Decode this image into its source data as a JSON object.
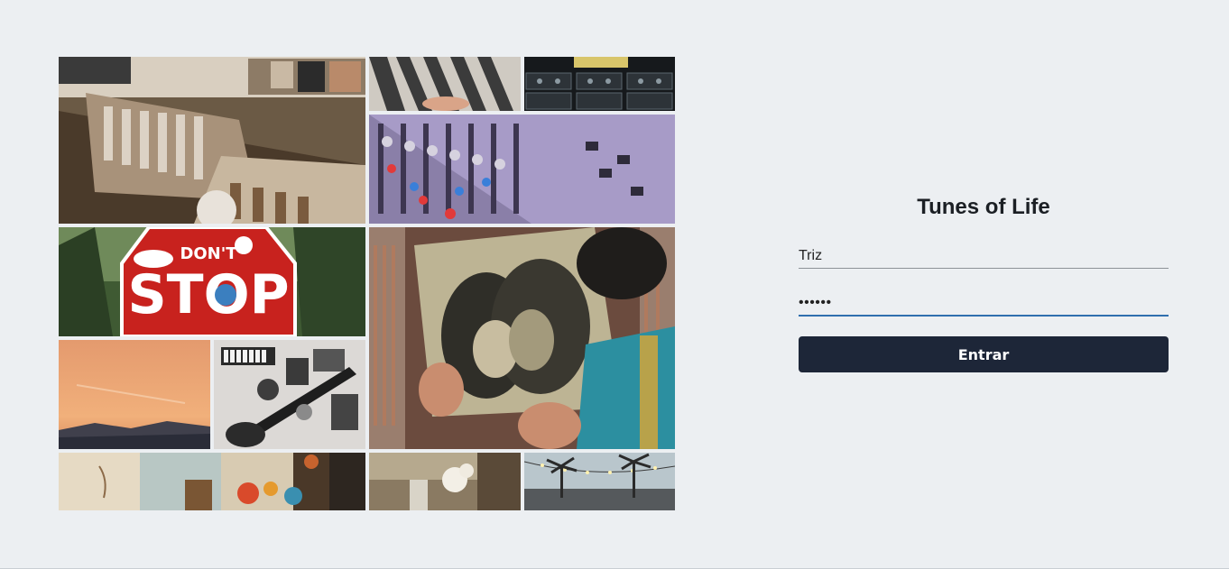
{
  "app": {
    "title": "Tunes of Life"
  },
  "login": {
    "username_value": "Triz",
    "password_value": "••••••",
    "submit_label": "Entrar"
  },
  "collage": {
    "tiles": [
      "record-store-tile",
      "vinyl-hand-tile",
      "cassettes-tile",
      "mixing-console-tile",
      "stop-sign-tile",
      "couple-kiss-tile",
      "sunset-tile",
      "flatlay-guitar-tile",
      "flowers-book-tile",
      "still-life-tile",
      "palm-lights-tile"
    ]
  },
  "colors": {
    "background": "#eceff2",
    "button": "#1d2638",
    "focus_underline": "#2f6fae"
  }
}
